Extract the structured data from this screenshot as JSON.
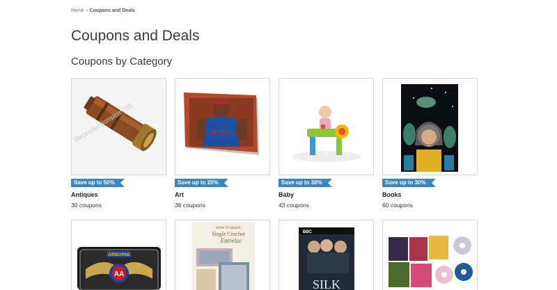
{
  "breadcrumb": {
    "home": "Home",
    "separator": "»",
    "current": "Coupons and Deals"
  },
  "page_title": "Coupons and Deals",
  "section_title": "Coupons by Category",
  "categories": [
    {
      "badge": "Save up to 50%",
      "name": "Antiques",
      "count": "30 coupons",
      "image": "antique-spyglass-image",
      "watermark": "Reproductionsical785"
    },
    {
      "badge": "Save up to 20%",
      "name": "Art",
      "count": "36 coupons",
      "image": "basketball-player-canvas-image",
      "jersey_text": "DETROIT"
    },
    {
      "badge": "Save up to 30%",
      "name": "Baby",
      "count": "43 coupons",
      "image": "baby-activity-table-image"
    },
    {
      "badge": "Save up to 30%",
      "name": "Books",
      "count": "60 coupons",
      "image": "comic-book-cover-image"
    }
  ],
  "row2": [
    {
      "image": "airborne-license-plate-image",
      "plate_text": "AIRBORNE",
      "logo_text": "AA"
    },
    {
      "image": "crochet-pattern-book-image",
      "title_lines": [
        "HOW TO MAKE",
        "Single Crochet",
        "Entrelac"
      ]
    },
    {
      "image": "silk-dvd-cover-image",
      "brand": "BBC",
      "title": "SILK"
    },
    {
      "image": "dvd-collection-image"
    }
  ],
  "colors": {
    "ribbon": "#3a86c4",
    "link": "#3a78b5",
    "card_border": "#d6d6d6"
  }
}
